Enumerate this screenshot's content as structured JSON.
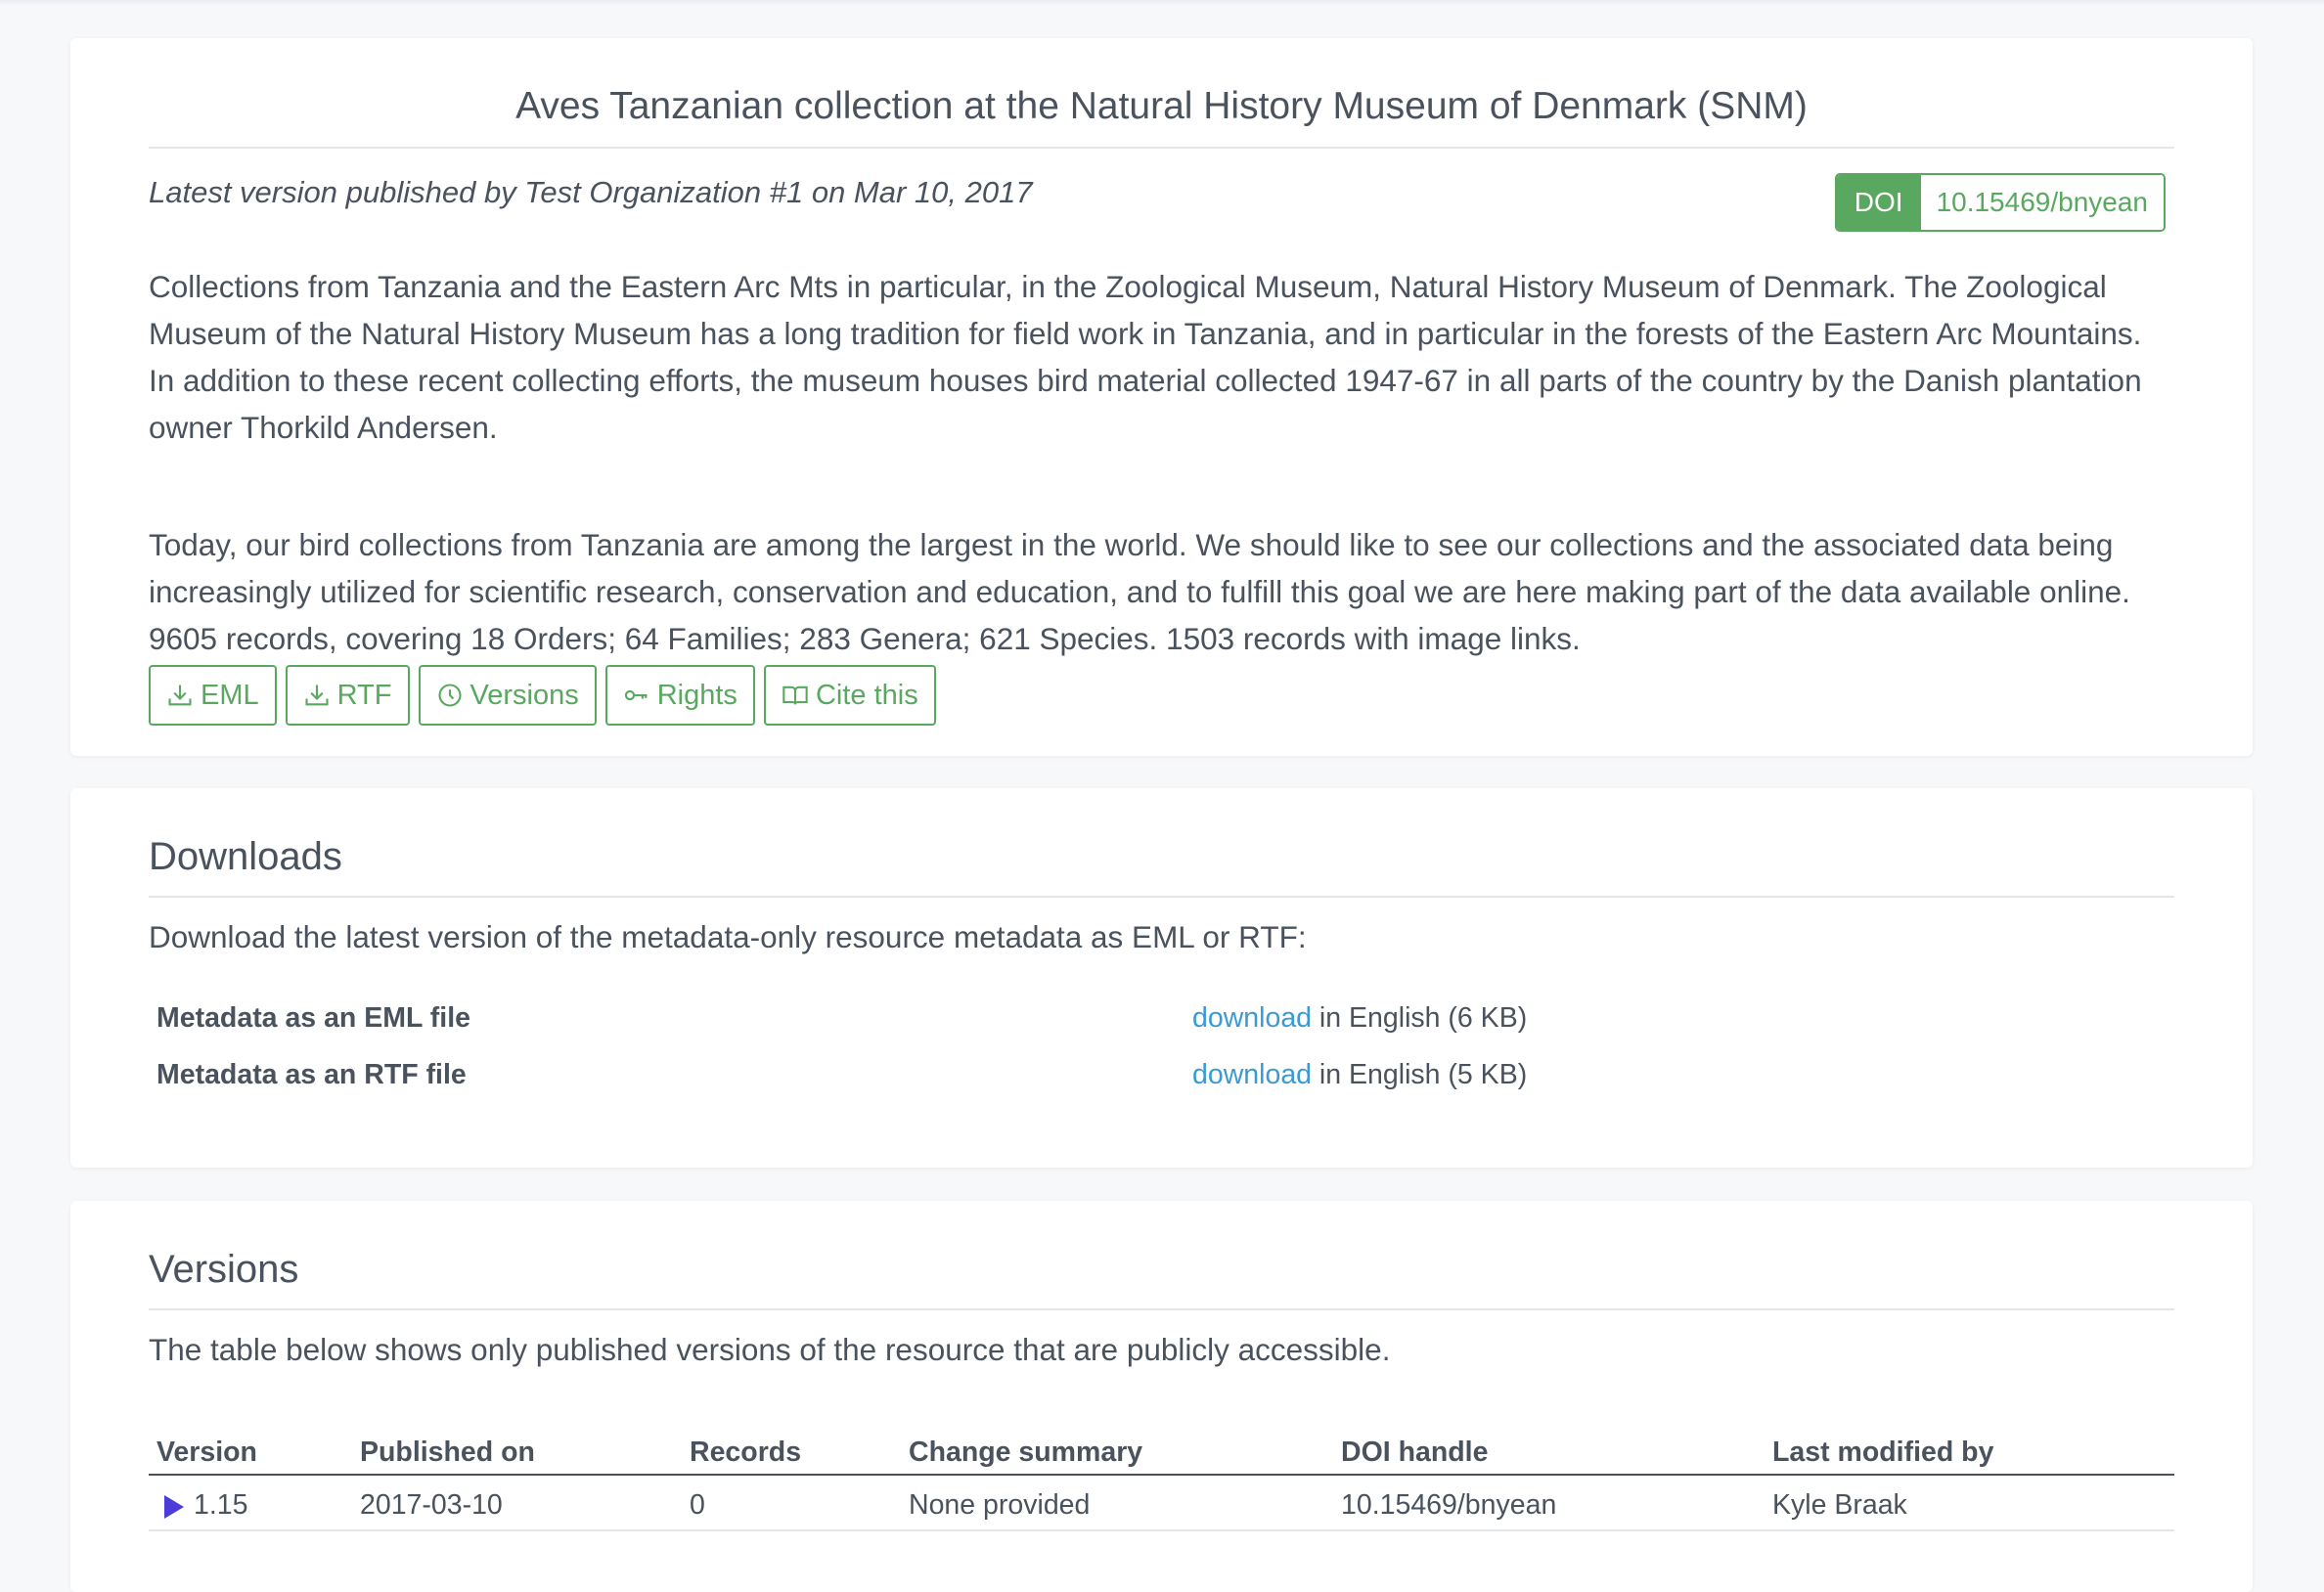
{
  "hero": {
    "title": "Aves Tanzanian collection at the Natural History Museum of Denmark (SNM)",
    "published_line": "Latest version published by Test Organization #1 on Mar 10, 2017",
    "doi_label": "DOI",
    "doi_value": "10.15469/bnyean",
    "paragraph1": "Collections from Tanzania and the Eastern Arc Mts in particular, in the Zoological Museum, Natural History Museum of Denmark. The Zoological Museum of the Natural History Museum has a long tradition for field work in Tanzania, and in particular in the forests of the Eastern Arc Mountains. In addition to these recent collecting efforts, the museum houses bird material collected 1947-67 in all parts of the country by the Danish plantation owner Thorkild Andersen.",
    "paragraph2": "Today, our bird collections from Tanzania are among the largest in the world. We should like to see our collections and the associated data being increasingly utilized for scientific research, conservation and education, and to fulfill this goal we are here making part of the data available online. 9605 records, covering 18 Orders; 64 Families; 283 Genera; 621 Species. 1503 records with image links.",
    "buttons": [
      {
        "label": "EML",
        "icon": "download-icon"
      },
      {
        "label": "RTF",
        "icon": "download-icon"
      },
      {
        "label": "Versions",
        "icon": "clock-icon"
      },
      {
        "label": "Rights",
        "icon": "key-icon"
      },
      {
        "label": "Cite this",
        "icon": "book-icon"
      }
    ]
  },
  "downloads": {
    "title": "Downloads",
    "description": "Download the latest version of the metadata-only resource metadata as EML or RTF:",
    "rows": [
      {
        "label": "Metadata as an EML file",
        "link": "download",
        "detail": " in English (6 KB)"
      },
      {
        "label": "Metadata as an RTF file",
        "link": "download",
        "detail": " in English (5 KB)"
      }
    ]
  },
  "versions": {
    "title": "Versions",
    "description": "The table below shows only published versions of the resource that are publicly accessible.",
    "columns": [
      "Version",
      "Published on",
      "Records",
      "Change summary",
      "DOI handle",
      "Last modified by"
    ],
    "rows": [
      {
        "version": "1.15",
        "published_on": "2017-03-10",
        "records": "0",
        "change_summary": "None provided",
        "doi_handle": "10.15469/bnyean",
        "last_modified_by": "Kyle Braak"
      }
    ]
  },
  "colors": {
    "accent": "#5aa860",
    "link": "#3a9ad6",
    "text": "#4a525d",
    "current_marker": "#4b3bd9"
  }
}
